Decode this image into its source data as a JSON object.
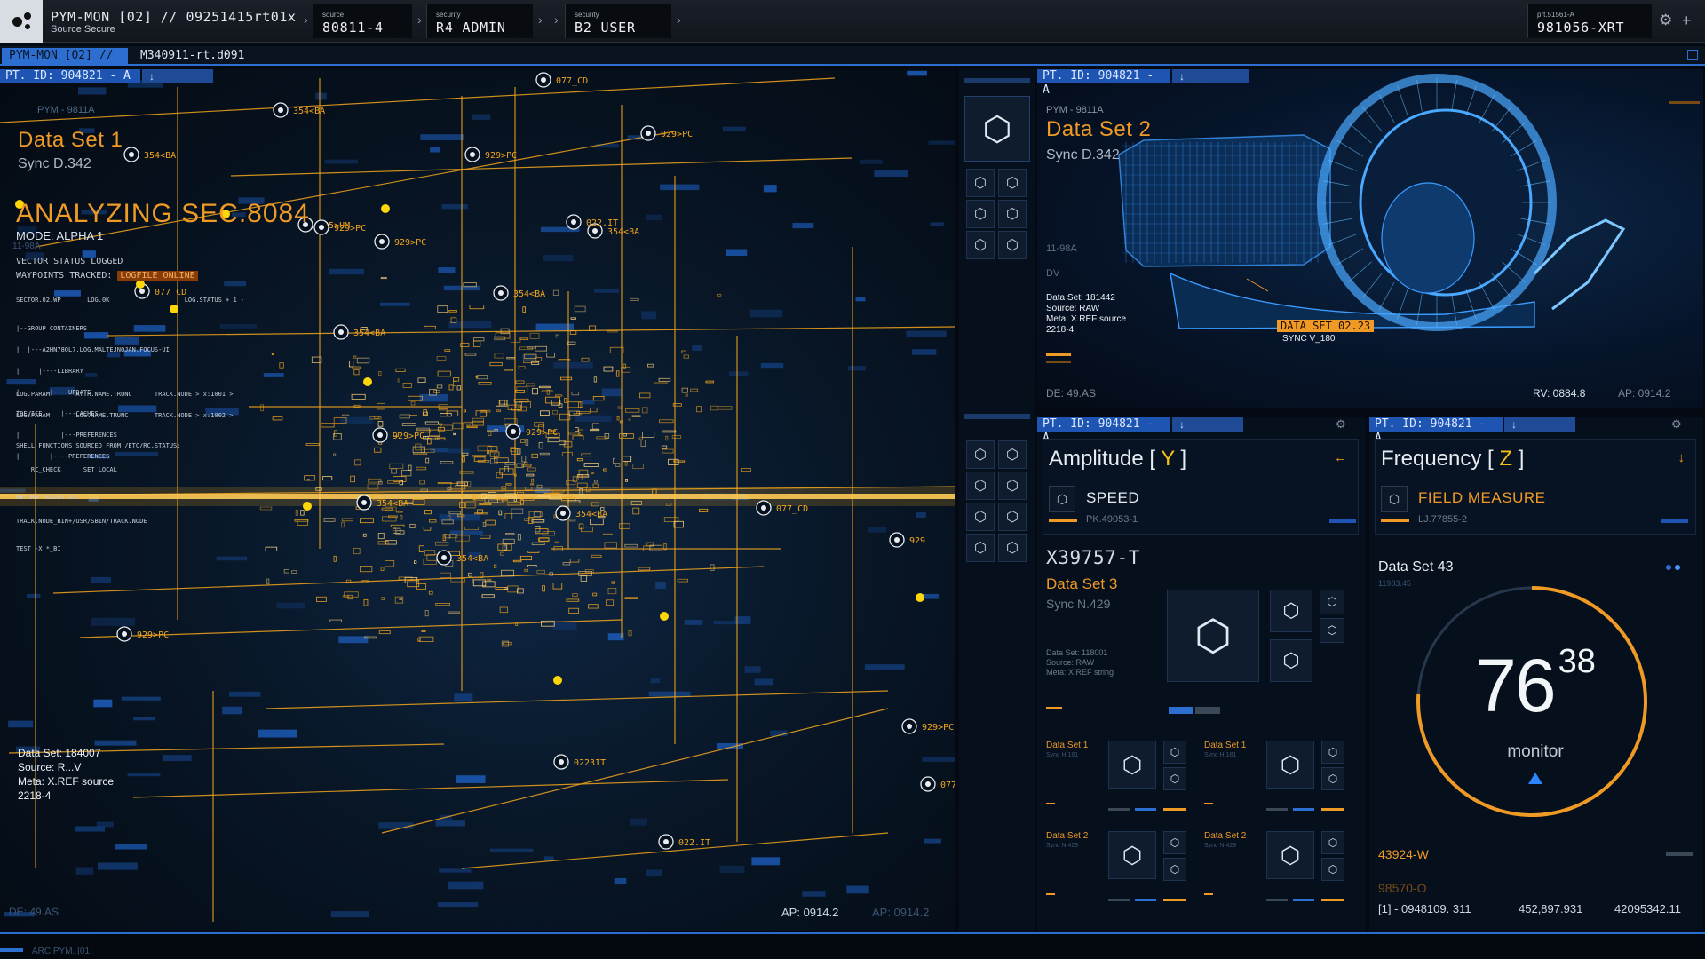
{
  "topbar": {
    "title": "PYM-MON [02] // 09251415rt01x",
    "subtitle": "Source Secure",
    "cells": [
      {
        "label": "source",
        "value": "80811-4"
      },
      {
        "label": "security",
        "value": "R4 ADMIN"
      },
      {
        "label": "security",
        "value": "B2 USER"
      }
    ],
    "right_label": "prt.51561-A",
    "right_value": "981056-XRT",
    "gear_icon": "gear-icon",
    "plus_icon": "plus-icon"
  },
  "tabs": {
    "active": "PYM-MON [02] //",
    "second": "M340911-rt.d091"
  },
  "left_panel": {
    "pt_label": "PT. ID: 904821 - A",
    "pym": "PYM - 9811A",
    "title": "Data Set 1",
    "sync": "Sync D.342",
    "analyzing": "ANALYZING SEC.8084",
    "mode": "MODE: ALPHA 1",
    "code": "11-98A",
    "status_lines": [
      "VECTOR STATUS LOGGED",
      "WAYPOINTS TRACKED: "
    ],
    "logfile_tag": "LOGFILE ONLINE",
    "log_header": [
      "SECTOR.02.WP",
      "LOG.0K",
      "LOG.STATUS + 1 -"
    ],
    "tree_lines": [
      "|--GROUP CONTAINERS",
      "|  |---A2HN78QL7.LOG.MALTEJNOJAN.FOCUS-UI",
      "|     |----LIBRARY",
      "|        |----UPDATE",
      "|           |---CACHES",
      "|           |---PREFERENCES",
      "|        |----PREFERENCES"
    ],
    "param_lines": [
      "LOG.PARAM       ATTR.NAME.TRUNC      TRACK.NODE > x:1001 >",
      "LOG.PARAM       LOG.NAME.TRUNC       TRACK.NODE > x:1002 >"
    ],
    "tdevice": "TDEVICE",
    "shell_lines": [
      "SHELL FUNCTIONS SOURCED FROM /ETC/RC.STATUS:",
      "    RC_CHECK      SET LOCAL",
      "RETURN VALUES ACC",
      "TRACK.NODE_BIN+/USR/SBIN/TRACK.NODE",
      "TEST -X *_BI"
    ],
    "dataset_lines": [
      "Data Set: 184007",
      "Source: R...V",
      "Meta: X.REF source",
      "2218-4"
    ],
    "de": "DE: 49.AS",
    "ap1": "AP: 0914.2",
    "ap2": "AP: 0914.2",
    "viz_labels": [
      "077_CD",
      "354<BA",
      "354<BA",
      "929>PC",
      "929>PC",
      "929>PC",
      "165>UM",
      "354<BA",
      "929>PC",
      "022.IT",
      "354<BA",
      "354<BA",
      "077_CD",
      "929>PC",
      "929",
      "354<BA",
      "929>PC",
      "077_CD",
      "0223IT",
      "022.IT"
    ]
  },
  "sidebar": {
    "big_icon": "cube-icon",
    "small_icon": "cube-icon"
  },
  "ds2": {
    "pt_label": "PT. ID: 904821 - A",
    "pym": "PYM - 9811A",
    "title": "Data Set 2",
    "sync": "Sync D.342",
    "code": "11-98A",
    "dv": "DV",
    "info_lines": [
      "Data Set: 181442",
      "Source: RAW",
      "Meta: X.REF source",
      "2218-4"
    ],
    "callout_title": "DATA SET 02.23",
    "callout_sync": "SYNC V_180",
    "de": "DE: 49.AS",
    "rv": "RV: 0884.8",
    "ap": "AP: 0914.2"
  },
  "amplitude": {
    "pt_label": "PT. ID: 904821 - A",
    "title_prefix": "Amplitude [ ",
    "axis": "Y",
    "title_suffix": " ]",
    "field_label": "SPEED",
    "field_code": "PK.49053-1",
    "id": "X39757-T",
    "ds_title": "Data Set 3",
    "ds_sync": "Sync N.429",
    "ds_lines": [
      "Data Set: 118001",
      "Source: RAW",
      "Meta: X.REF string"
    ],
    "mini_cards": [
      {
        "title": "Data Set 1",
        "sync": "Sync H.181"
      },
      {
        "title": "Data Set 1",
        "sync": "Sync H.181"
      },
      {
        "title": "Data Set 2",
        "sync": "Sync N.429"
      },
      {
        "title": "Data Set 2",
        "sync": "Sync N.429"
      }
    ]
  },
  "frequency": {
    "pt_label": "PT. ID: 904821 - A",
    "title_prefix": "Frequency [ ",
    "axis": "Z",
    "title_suffix": " ]",
    "field_label": "FIELD MEASURE",
    "field_code": "LJ.77855-2",
    "ds_title": "Data Set 43",
    "ds_code": "11983.45",
    "gauge_major": "76",
    "gauge_minor": "38",
    "gauge_label": "monitor",
    "gauge_fraction": 0.76,
    "code1": "43924-W",
    "code2": "98570-O",
    "footer": [
      "[1] - 0948109. 311",
      "452,897.931",
      "42095342.11"
    ]
  },
  "bottom": {
    "label": "ARC PYM. [01]"
  },
  "colors": {
    "accent_blue": "#1e55b3",
    "accent_orange": "#f09a26",
    "accent_yellow": "#f5c014"
  }
}
